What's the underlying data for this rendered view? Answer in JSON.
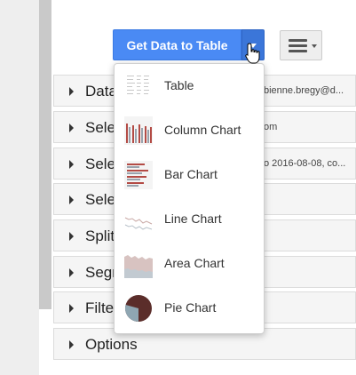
{
  "toolbar": {
    "get_data_label": "Get Data to Table"
  },
  "icons": {
    "dropdown_caret": "caret-down-icon",
    "menu": "hamburger-menu-icon",
    "cursor": "hand-pointer-icon",
    "row_arrow": "chevron-right-icon"
  },
  "panels": [
    {
      "label": "Data",
      "extra": "bienne.bregy@d..."
    },
    {
      "label": "Sele",
      "extra": "om"
    },
    {
      "label": "Sele",
      "extra": "o 2016-08-08, co..."
    },
    {
      "label": "Sele",
      "extra": ""
    },
    {
      "label": "Split",
      "extra": ""
    },
    {
      "label": "Segm",
      "extra": ""
    },
    {
      "label": "Filte",
      "extra": ""
    },
    {
      "label": "Options",
      "extra": ""
    }
  ],
  "dropdown": {
    "items": [
      {
        "label": "Table",
        "icon": "table-thumbnail"
      },
      {
        "label": "Column Chart",
        "icon": "column-chart-thumbnail"
      },
      {
        "label": "Bar Chart",
        "icon": "bar-chart-thumbnail"
      },
      {
        "label": "Line Chart",
        "icon": "line-chart-thumbnail"
      },
      {
        "label": "Area Chart",
        "icon": "area-chart-thumbnail"
      },
      {
        "label": "Pie Chart",
        "icon": "pie-chart-thumbnail"
      }
    ]
  },
  "colors": {
    "primary_button": "#4a8af4",
    "primary_button_dark": "#3b76d9",
    "column_red": "#b34b45",
    "column_gray": "#9aa3ad",
    "pie_dark": "#5b2d2a",
    "pie_blue": "#8fa6b2"
  }
}
